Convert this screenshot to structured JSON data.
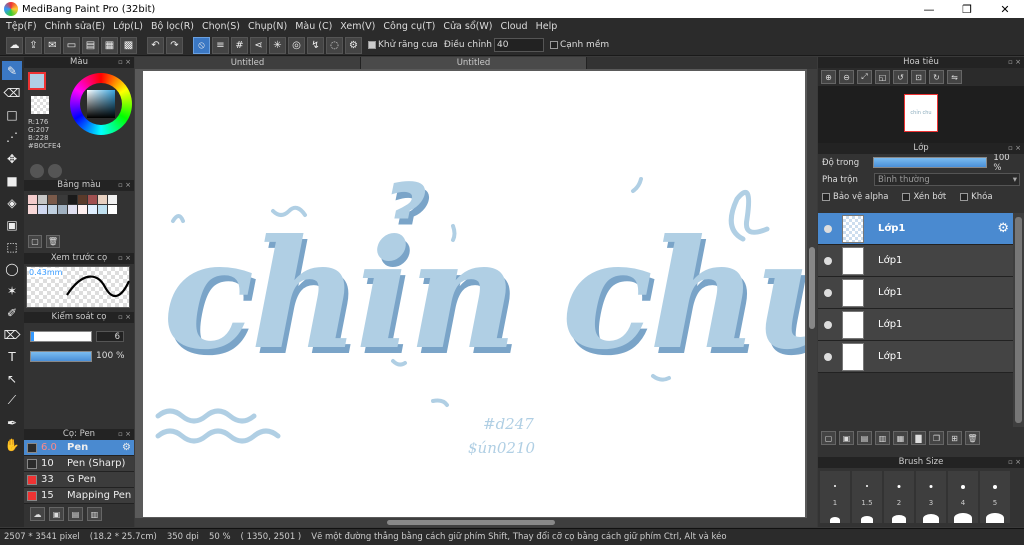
{
  "window": {
    "title": "MediBang Paint Pro (32bit)",
    "minimize": "—",
    "restore": "❐",
    "close": "✕"
  },
  "menu": [
    "Tệp(F)",
    "Chỉnh sửa(E)",
    "Lớp(L)",
    "Bộ lọc(R)",
    "Chọn(S)",
    "Chụp(N)",
    "Màu (C)",
    "Xem(V)",
    "Công cụ(T)",
    "Cửa sổ(W)",
    "Cloud",
    "Help"
  ],
  "toolbar": {
    "antialias_label": "Khử răng cưa",
    "correction_label": "Điều chỉnh",
    "correction_value": "40",
    "edge_label": "Cạnh mềm"
  },
  "color_panel": {
    "title": "Màu",
    "fg_color": "#b0cfe4",
    "r": "R:176",
    "g": "G:207",
    "b": "B:228",
    "hex": "#B0CFE4"
  },
  "palette_panel": {
    "title": "Bảng màu",
    "colors": [
      "#f4cccc",
      "#c6c6c6",
      "#7a5a4a",
      "#3a3a3a",
      "#1a1a1a",
      "#5a3a2a",
      "#a05050",
      "#e8d0c0",
      "#f0f0f0",
      "#f8d8d8",
      "#d0d8f0",
      "#c0d0e0",
      "#a0b0c0",
      "#e0e0f0",
      "#fff0f0",
      "#e0f0ff",
      "#c0e0f0",
      "#ffffff"
    ]
  },
  "brush_preview": {
    "title": "Xem trước cọ",
    "size": "0.43mm"
  },
  "brush_control": {
    "title": "Kiểm soát cọ",
    "size": "6",
    "opacity": "100 %"
  },
  "brush_list": {
    "title": "Cọ: Pen",
    "items": [
      {
        "size": "6.0",
        "name": "Pen",
        "color": "#2b2b2b",
        "active": true
      },
      {
        "size": "10",
        "name": "Pen (Sharp)",
        "color": "#2b2b2b"
      },
      {
        "size": "33",
        "name": "G Pen",
        "color": "#e33"
      },
      {
        "size": "15",
        "name": "Mapping Pen",
        "color": "#e33"
      }
    ]
  },
  "tabs": [
    "Untitled",
    "Untitled"
  ],
  "canvas": {
    "main_text": "chỉn chu",
    "small1": "#d247",
    "small2": "$ún0210",
    "ink": "#b0cfe4",
    "shade": "#7aa4c8"
  },
  "navigator": {
    "title": "Hoa tiêu",
    "thumb_text": "chỉn chu"
  },
  "layer_panel": {
    "title": "Lớp",
    "opacity_label": "Độ trong",
    "opacity_value": "100 %",
    "blend_label": "Pha trộn",
    "blend_value": "Bình thường",
    "protect_alpha": "Bảo vệ alpha",
    "clip": "Xén bớt",
    "lock": "Khóa",
    "layers": [
      "Lớp1",
      "Lớp1",
      "Lớp1",
      "Lớp1",
      "Lớp1"
    ]
  },
  "brush_size": {
    "title": "Brush Size",
    "labels": [
      "1",
      "1.5",
      "2",
      "3",
      "4",
      "5"
    ]
  },
  "status": {
    "dims": "2507 * 3541 pixel",
    "mm": "(18.2 * 25.7cm)",
    "dpi": "350 dpi",
    "zoom": "50 %",
    "coords": "( 1350, 2501 )",
    "hint": "Vẽ một đường thẳng bằng cách giữ phím Shift, Thay đổi cỡ cọ bằng cách giữ phím Ctrl, Alt và kéo"
  }
}
